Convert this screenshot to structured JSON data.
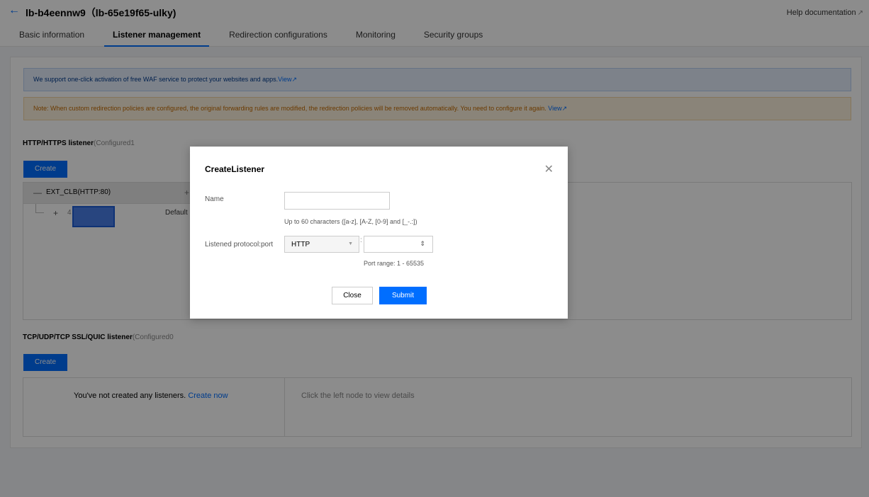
{
  "header": {
    "title": "lb-b4eennw9（lb-65e19f65-ulky)",
    "help_label": "Help documentation",
    "tabs": [
      {
        "label": "Basic information"
      },
      {
        "label": "Listener management"
      },
      {
        "label": "Redirection configurations"
      },
      {
        "label": "Monitoring"
      },
      {
        "label": "Security groups"
      }
    ],
    "active_tab": "Listener management"
  },
  "banners": {
    "info_text": "We support one-click activation of free WAF service to protect your websites and apps.",
    "info_link": "View",
    "warn_text": "Note: When custom redirection policies are configured, the original forwarding rules are modified, the redirection policies will be removed automatically. You need to configure it again.",
    "warn_link": "View"
  },
  "http_section": {
    "heading": "HTTP/HTTPS listener",
    "count_label": "(Configured1",
    "create_label": "Create",
    "tree_label": "EXT_CLB(HTTP:80)",
    "child_num": "4",
    "default_text": "Default r"
  },
  "tcp_section": {
    "heading": "TCP/UDP/TCP SSL/QUIC listener",
    "count_label": "(Configured0",
    "create_label": "Create",
    "empty_text": "You've not created any listeners.",
    "create_now": "Create now",
    "right_text": "Click the left node to view details"
  },
  "modal": {
    "title": "CreateListener",
    "name_label": "Name",
    "name_value": "",
    "name_hint": "Up to 60 characters ([a-z], [A-Z, [0-9] and [_-.:])",
    "protocol_label": "Listened protocol:port",
    "protocol_value": "HTTP",
    "colon": ":",
    "port_value": "",
    "port_hint": "Port range: 1 - 65535",
    "close_label": "Close",
    "submit_label": "Submit"
  },
  "colors": {
    "accent": "#006eff",
    "overlay": "rgba(0,0,0,0.45)"
  }
}
